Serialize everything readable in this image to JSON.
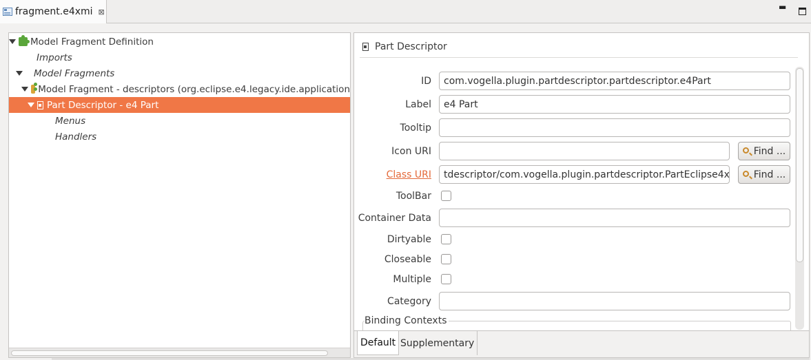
{
  "editor_tab": {
    "title": "fragment.e4xmi",
    "close_symbol": "⊠"
  },
  "window_controls": {
    "minimize": "▬"
  },
  "tree": {
    "items": [
      {
        "label": "Model Fragment Definition",
        "italic": false
      },
      {
        "label": "Imports",
        "italic": true
      },
      {
        "label": "Model Fragments",
        "italic": true
      },
      {
        "label": "Model Fragment - descriptors (org.eclipse.e4.legacy.ide.application",
        "italic": false
      },
      {
        "label": "Part Descriptor - e4 Part",
        "italic": false,
        "selected": true
      },
      {
        "label": "Menus",
        "italic": true
      },
      {
        "label": "Handlers",
        "italic": true
      }
    ]
  },
  "detail": {
    "section_title": "Part Descriptor",
    "fields": {
      "id": {
        "label": "ID",
        "value": "com.vogella.plugin.partdescriptor.partdescriptor.e4Part"
      },
      "label": {
        "label": "Label",
        "value": "e4 Part"
      },
      "tooltip": {
        "label": "Tooltip",
        "value": ""
      },
      "icon_uri": {
        "label": "Icon URI",
        "value": ""
      },
      "class_uri": {
        "label": "Class URI",
        "value": "tdescriptor/com.vogella.plugin.partdescriptor.PartEclipse4x"
      },
      "toolbar": {
        "label": "ToolBar",
        "checked": false
      },
      "container_data": {
        "label": "Container Data",
        "value": ""
      },
      "dirtyable": {
        "label": "Dirtyable",
        "checked": false
      },
      "closeable": {
        "label": "Closeable",
        "checked": false
      },
      "multiple": {
        "label": "Multiple",
        "checked": false
      },
      "category": {
        "label": "Category",
        "value": ""
      }
    },
    "find_button_label": "Find ...",
    "binding_contexts_label": "Binding Contexts",
    "tabs": [
      "Default",
      "Supplementary"
    ],
    "active_tab": "Default"
  },
  "colors": {
    "selection": "#f07746",
    "link": "#e46a3a"
  },
  "icons": {
    "tab": "e4xmi-editor-icon",
    "fragment_definition": "puzzle-piece-icon",
    "model_fragment": "puzzle-piece-mixed-icon",
    "part_descriptor": "part-descriptor-icon",
    "find": "magnifier-icon"
  }
}
